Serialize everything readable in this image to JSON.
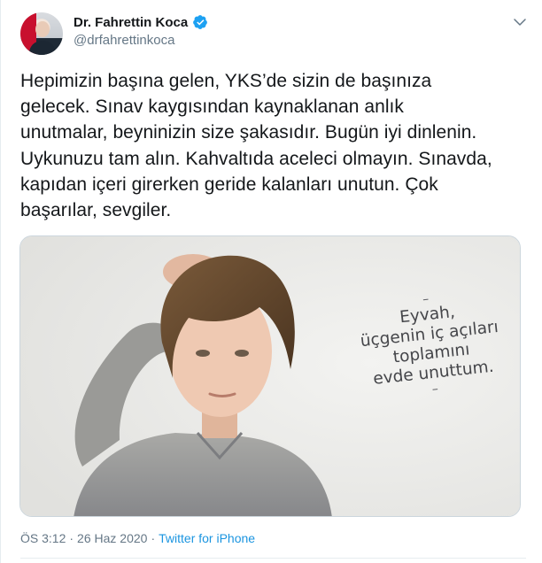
{
  "author": {
    "display_name": "Dr. Fahrettin Koca",
    "handle": "@drfahrettinkoca",
    "verified_icon": "verified-badge-icon",
    "verified_color": "#1da1f2"
  },
  "menu_icon": "chevron-down-icon",
  "tweet": {
    "text": "Hepimizin başına gelen, YKS’de sizin de başınıza\ngelecek. Sınav kaygısından kaynaklanan anlık\nunutmalar, beyninizin size şakasıdır. Bugün iyi dinlenin.\nUykunuzu tam alın. Kahvaltıda aceleci olmayın. Sınavda,\nkapıdan içeri girerken geride kalanları unutun. Çok\nbaşarılar, sevgiler."
  },
  "media": {
    "quote_lines": [
      "Eyvah,",
      "üçgenin iç açıları",
      "toplamını",
      "evde unuttum."
    ],
    "dash_top": "–",
    "dash_bottom": "–"
  },
  "footer": {
    "time": "ÖS 3:12",
    "separator1": "·",
    "date": "26 Haz 2020",
    "separator2": "·",
    "source": "Twitter for iPhone",
    "source_color": "#1b95e0"
  }
}
